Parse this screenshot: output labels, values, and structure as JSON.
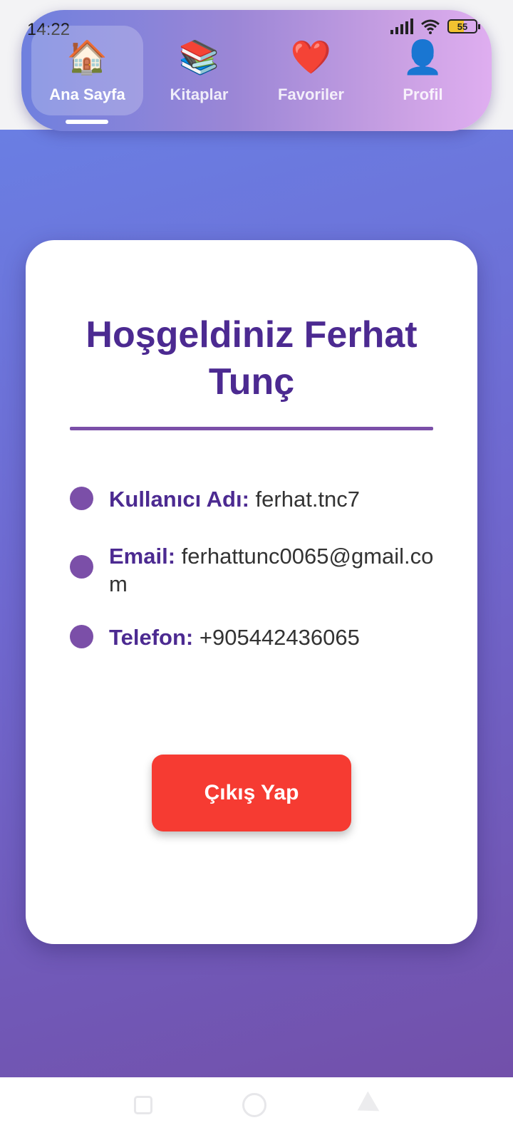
{
  "status_bar": {
    "time": "14:22",
    "battery": "55"
  },
  "nav": {
    "tabs": [
      {
        "label": "Ana Sayfa",
        "icon": "🏠",
        "active": true
      },
      {
        "label": "Kitaplar",
        "icon": "📚",
        "active": false
      },
      {
        "label": "Favoriler",
        "icon": "❤️",
        "active": false
      },
      {
        "label": "Profil",
        "icon": "👤",
        "active": false
      }
    ]
  },
  "profile": {
    "welcome": "Hoşgeldiniz Ferhat Tunç",
    "fields": [
      {
        "key": "Kullanıcı Adı:",
        "value": "ferhat.tnc7"
      },
      {
        "key": "Email:",
        "value": "ferhattunc0065@gmail.com"
      },
      {
        "key": "Telefon:",
        "value": "+905442436065"
      }
    ],
    "logout_label": "Çıkış Yap"
  },
  "colors": {
    "title": "#4c2a91",
    "accent": "#7b4fa8",
    "logout": "#f63b32"
  }
}
